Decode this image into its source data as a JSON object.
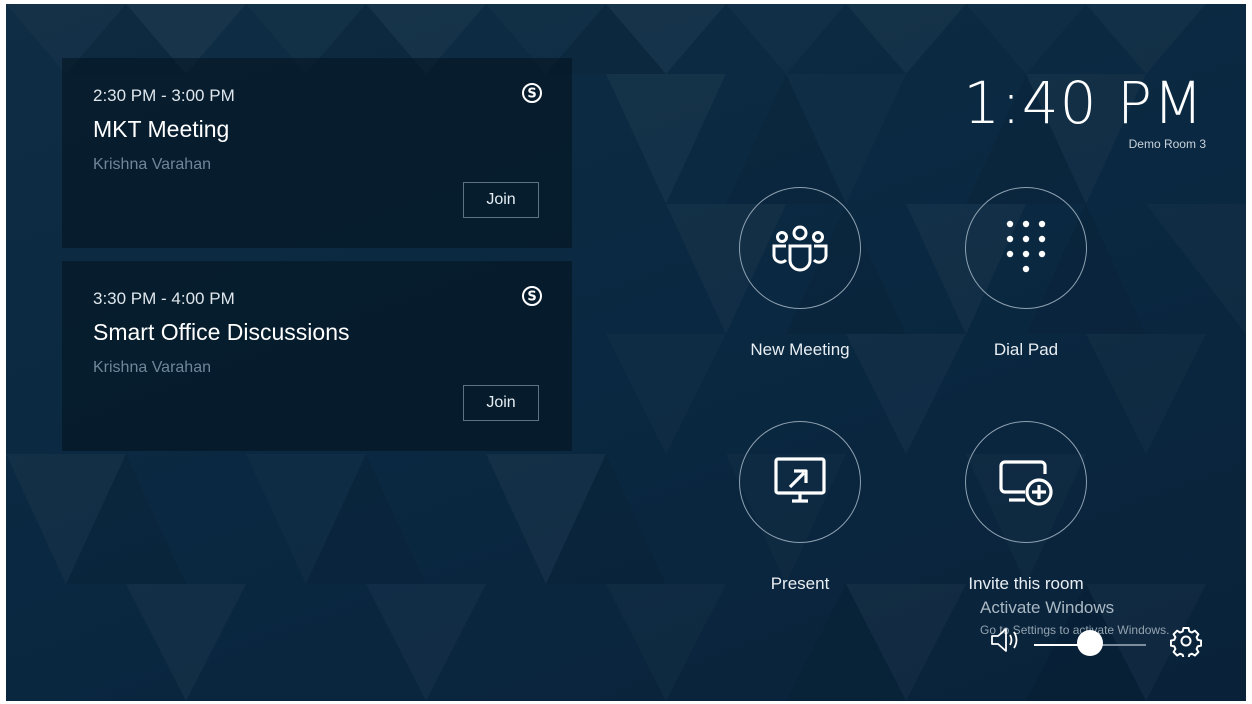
{
  "meetings": [
    {
      "time": "2:30 PM - 3:00 PM",
      "title": "MKT Meeting",
      "organizer": "Krishna Varahan",
      "join_label": "Join",
      "icon": "skype-icon"
    },
    {
      "time": "3:30 PM - 4:00 PM",
      "title": "Smart Office Discussions",
      "organizer": "Krishna Varahan",
      "join_label": "Join",
      "icon": "skype-icon"
    }
  ],
  "clock": {
    "time": "1:40 PM",
    "room": "Demo Room 3"
  },
  "actions": [
    {
      "label": "New Meeting",
      "icon": "teams-people-icon"
    },
    {
      "label": "Dial Pad",
      "icon": "dialpad-icon"
    },
    {
      "label": "Present",
      "icon": "present-screen-icon"
    },
    {
      "label": "Invite this room",
      "icon": "invite-room-icon"
    }
  ],
  "watermark": {
    "title": "Activate Windows",
    "subtitle": "Go to Settings to activate Windows."
  },
  "volume": {
    "level": 0.5,
    "icon": "speaker-icon"
  },
  "settings": {
    "icon": "gear-icon"
  },
  "colors": {
    "background": "#0b2a42",
    "card": "#04121e",
    "organizer_text": "#6f8699",
    "circle_border": "#8ea1b0"
  }
}
